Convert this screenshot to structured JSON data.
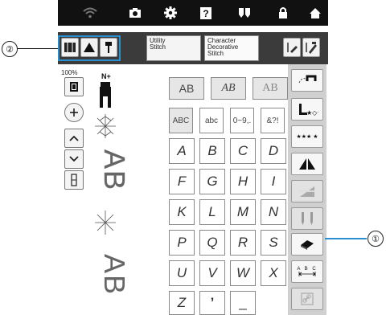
{
  "callouts": {
    "one": "①",
    "two": "②"
  },
  "toolbar": {
    "utility_tab_line1": "Utility",
    "utility_tab_line2": "Stitch",
    "character_tab_line1": "Character",
    "character_tab_line2": "Decorative",
    "character_tab_line3": "Stitch"
  },
  "left_panel": {
    "zoom_label": "100%",
    "needle_label": "N+"
  },
  "font_buttons": [
    "AB",
    "AB",
    "AB"
  ],
  "mode_buttons": [
    "ABC",
    "abc",
    "0~9,.",
    "&?!"
  ],
  "letters": [
    "A",
    "B",
    "C",
    "D",
    "F",
    "G",
    "H",
    "I",
    "K",
    "L",
    "M",
    "N",
    "P",
    "Q",
    "R",
    "S",
    "U",
    "V",
    "W",
    "X",
    "Z",
    "’",
    "_"
  ],
  "preview": {
    "text_top": "AB",
    "text_bottom": "AB"
  },
  "right_panel": {
    "stars_label": "★★★ ★",
    "spacing_label": "A B C"
  },
  "colors": {
    "topbar": "#111111",
    "toolbar": "#3b3b3b",
    "panel": "#d0d0d0",
    "accent": "#2a8fd0"
  }
}
